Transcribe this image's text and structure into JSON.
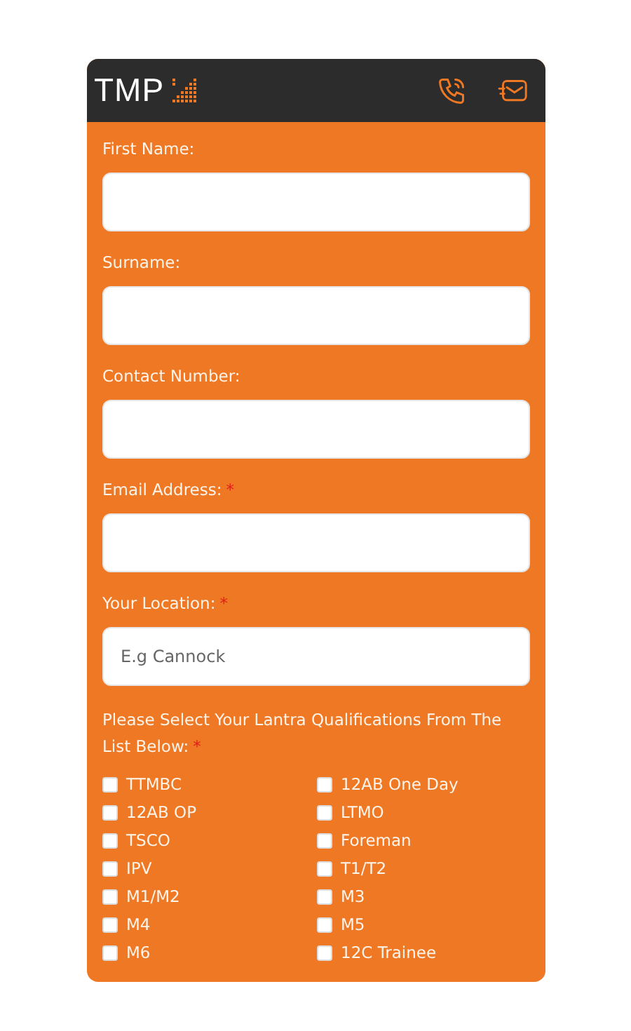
{
  "header": {
    "logo_text": "TMP",
    "icons": [
      {
        "kind": "phone"
      },
      {
        "kind": "mail"
      }
    ]
  },
  "fields": [
    {
      "label": "First Name:"
    },
    {
      "label": "Surname:"
    },
    {
      "label": "Contact Number:"
    },
    {
      "label": "Email Address:",
      "required_mark": "*"
    },
    {
      "label": "Your Location:",
      "required_mark": "*",
      "placeholder": "E.g Cannock"
    }
  ],
  "qualifications": {
    "label": "Please Select Your Lantra Qualifications From The List Below:",
    "required_mark": "*",
    "options": [
      {
        "label": "TTMBC",
        "checked": false
      },
      {
        "label": "12AB One Day",
        "checked": false
      },
      {
        "label": "12AB OP",
        "checked": false
      },
      {
        "label": "LTMO",
        "checked": false
      },
      {
        "label": "TSCO",
        "checked": false
      },
      {
        "label": "Foreman",
        "checked": false
      },
      {
        "label": "IPV",
        "checked": false
      },
      {
        "label": "T1/T2",
        "checked": false
      },
      {
        "label": "M1/M2",
        "checked": false
      },
      {
        "label": "M3",
        "checked": false
      },
      {
        "label": "M4",
        "checked": false
      },
      {
        "label": "M5",
        "checked": false
      },
      {
        "label": "M6",
        "checked": false
      },
      {
        "label": "12C Trainee",
        "checked": false
      }
    ]
  }
}
